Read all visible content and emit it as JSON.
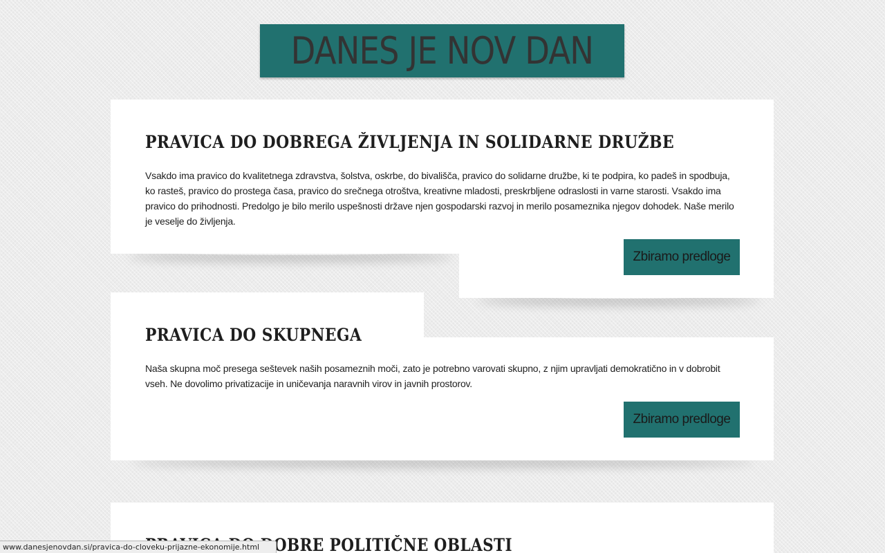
{
  "site": {
    "logo_text": "DANES JE NOV DAN"
  },
  "posts": [
    {
      "title": "PRAVICA DO DOBREGA ŽIVLJENJA IN SOLIDARNE DRUŽBE",
      "body": "Vsakdo ima pravico do kvalitetnega zdravstva, šolstva, oskrbe, do bivališča, pravico do solidarne družbe, ki te podpira, ko padeš in spodbuja, ko rasteš, pravico do prostega časa, pravico do srečnega otroštva, kreativne mladosti, preskrbljene odraslosti in varne starosti. Vsakdo ima pravico do prihodnosti. Predolgo je bilo merilo uspešnosti države njen gospodarski razvoj in merilo posameznika njegov dohodek. Naše merilo je veselje do življenja.",
      "button_label": "Zbiramo predloge"
    },
    {
      "title": "PRAVICA DO SKUPNEGA",
      "body": "Naša skupna moč presega seštevek naših posameznih moči, zato je potrebno varovati skupno, z njim upravljati demokratično in v dobrobit vseh. Ne dovolimo privatizacije in uničevanja naravnih virov in javnih prostorov.",
      "button_label": "Zbiramo predloge"
    },
    {
      "title": "PRAVICA DO DOBRE POLITIČNE OBLASTI"
    }
  ],
  "status_bar": {
    "url": "www.danesjenovdan.si/pravica-do-cloveku-prijazne-ekonomije.html"
  },
  "colors": {
    "accent": "#21716f",
    "background": "#ececec",
    "panel": "#ffffff",
    "text": "#1e1e1e"
  }
}
